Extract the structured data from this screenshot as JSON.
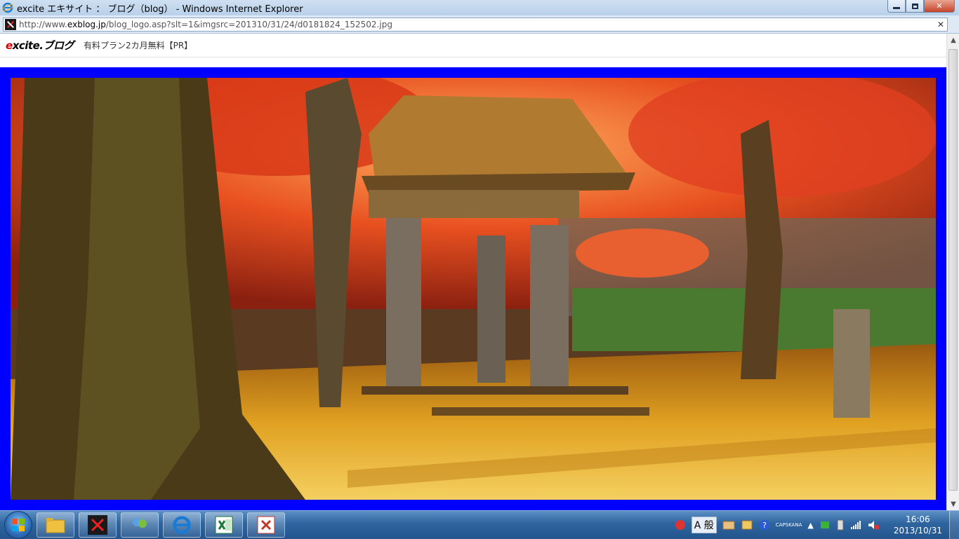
{
  "window": {
    "title": "excite エキサイト ： ブログ（blog） - Windows Internet Explorer",
    "minimize_label": "▭",
    "maximize_label": "❐",
    "close_label": "✕"
  },
  "address": {
    "url_prefix": "http://www.",
    "url_domain": "exblog.jp",
    "url_path": "/blog_logo.asp?slt=1&imgsrc=201310/31/24/d0181824_152502.jpg",
    "close_glyph": "✕"
  },
  "page": {
    "logo_prefix": "e",
    "logo_rest": "xcite.ブログ",
    "promo_text": "有料プラン2カ月無料【PR】",
    "photo_description_icon": "autumn-temple-gate-photo"
  },
  "taskbar": {
    "items": [
      {
        "name": "file-explorer-icon"
      },
      {
        "name": "excite-blog-icon"
      },
      {
        "name": "windows-live-messenger-icon"
      },
      {
        "name": "internet-explorer-icon"
      },
      {
        "name": "excel-icon"
      },
      {
        "name": "presentation-icon"
      }
    ],
    "ime_label": "A 般",
    "caps_label": "CAPS",
    "kana_label": "KANA",
    "time": "16:06",
    "date": "2013/10/31"
  },
  "colors": {
    "frame": "#0000ff",
    "taskbar": "#2f659f"
  }
}
